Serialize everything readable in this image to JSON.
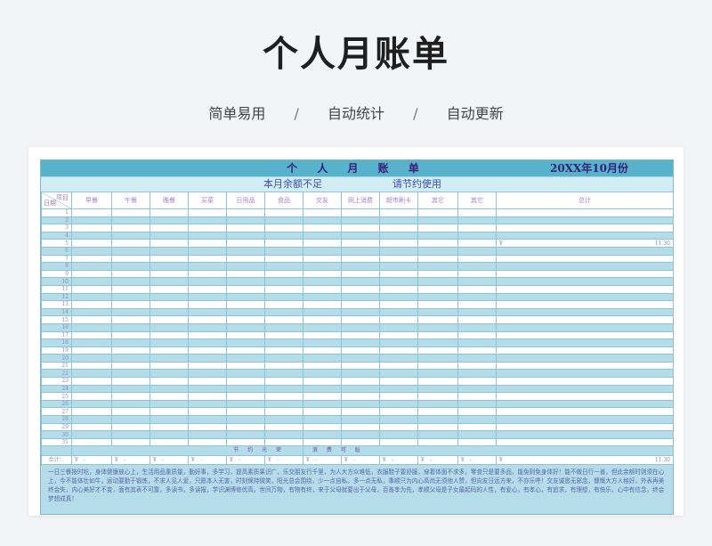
{
  "header": {
    "title": "个人月账单",
    "features": [
      "简单易用",
      "自动统计",
      "自动更新"
    ],
    "separator": "/"
  },
  "sheet": {
    "title": "个 人 月 账 单",
    "month": "20XX年10月份",
    "balance_notice": "本月余额不足",
    "save_notice": "请节约使用",
    "corner_top": "项目",
    "corner_bottom": "日期",
    "columns": [
      "早餐",
      "午餐",
      "晚餐",
      "买菜",
      "日用品",
      "食品",
      "交友",
      "网上消费",
      "超市刷卡",
      "其它",
      "其它",
      "总计"
    ],
    "days": [
      "1",
      "2",
      "3",
      "4",
      "5",
      "6",
      "7",
      "8",
      "9",
      "10",
      "11",
      "12",
      "13",
      "14",
      "15",
      "16",
      "17",
      "18",
      "19",
      "20",
      "21",
      "22",
      "23",
      "24",
      "25",
      "26",
      "27",
      "28",
      "29",
      "30",
      "31"
    ],
    "highlight_row": {
      "day": "5",
      "currency": "¥",
      "total": "11.30"
    },
    "footer_left": "节 约 光 荣",
    "footer_right": "浪 费 可 耻",
    "sum_label": "合计：",
    "currency": "¥",
    "dash": "-",
    "sum_total": "11.30",
    "note": "一日三餐按时吃，身体健康放心上，生活用品重质量，勤好事，多学习，提高素质果识广，乐交朋友行千里，为人大方众难低，衣服鞋子要舒服，穿着体面不求多，零食只是要多品，能免则免身体好！能不做日行一善，但此余额时则须在心上，今不能体壮如牛，运动要勤于锻炼，不求人见人爱，只愿本人无害，时刻保持微笑，阳光总会围绕，少一点自私，多一点无私，事顺只为内心高尚无须他人赞，但向友日远方来，不亦乐呼！交友诚恳无邪念，慷慨大方人格好，外表再美终会失，内心美好才不变，面有其表不可靠，多读书，多读报，学识渊博修优高。世间万物，有物有终，来于父母就要出于父母，百善孝为先，孝顺父母是子女最起码的人性，有爱心，有孝心，有追求，有理想，有快乐，心中有信念，终会梦想成真！"
  }
}
